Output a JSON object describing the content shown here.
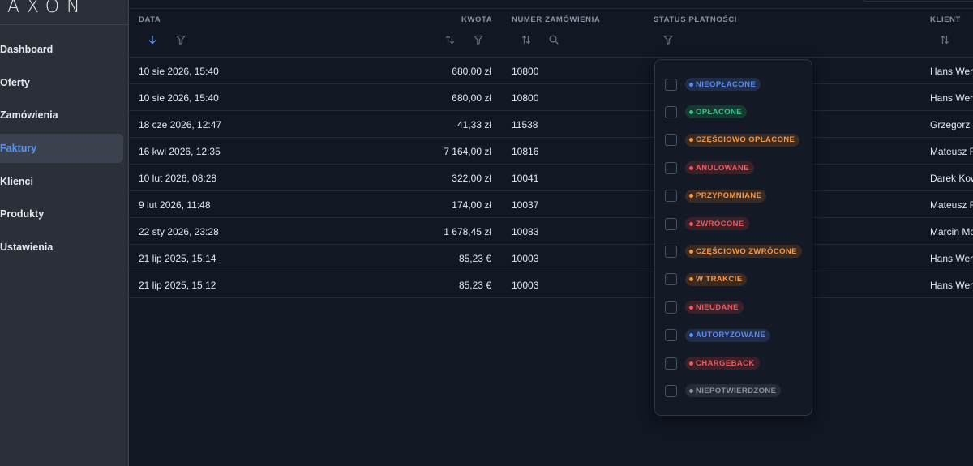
{
  "app": {
    "logo": "AXON"
  },
  "sidebar": {
    "items": [
      {
        "label": "Dashboard",
        "active": false
      },
      {
        "label": "Oferty",
        "active": false
      },
      {
        "label": "Zamówienia",
        "active": false
      },
      {
        "label": "Faktury",
        "active": true
      },
      {
        "label": "Klienci",
        "active": false
      },
      {
        "label": "Produkty",
        "active": false
      },
      {
        "label": "Ustawienia",
        "active": false
      }
    ]
  },
  "table": {
    "headers": {
      "date": "DATA",
      "amount": "KWOTA",
      "order_number": "NUMER ZAMÓWIENIA",
      "payment_status": "STATUS PŁATNOŚCI",
      "client": "KLIENT"
    },
    "rows": [
      {
        "date": "10 sie 2026, 15:40",
        "amount": "680,00 zł",
        "order": "10800",
        "client": "Hans Werr"
      },
      {
        "date": "10 sie 2026, 15:40",
        "amount": "680,00 zł",
        "order": "10800",
        "client": "Hans Werr"
      },
      {
        "date": "18 cze 2026, 12:47",
        "amount": "41,33 zł",
        "order": "11538",
        "client": "Grzegorz"
      },
      {
        "date": "16 kwi 2026, 12:35",
        "amount": "7 164,00 zł",
        "order": "10816",
        "client": "Mateusz F"
      },
      {
        "date": "10 lut 2026, 08:28",
        "amount": "322,00 zł",
        "order": "10041",
        "client": "Darek Kow"
      },
      {
        "date": "9 lut 2026, 11:48",
        "amount": "174,00 zł",
        "order": "10037",
        "client": "Mateusz F"
      },
      {
        "date": "22 sty 2026, 23:28",
        "amount": "1 678,45 zł",
        "order": "10083",
        "client": "Marcin Mc"
      },
      {
        "date": "21 lip 2025, 15:14",
        "amount": "85,23 €",
        "order": "10003",
        "client": "Hans Werr"
      },
      {
        "date": "21 lip 2025, 15:12",
        "amount": "85,23 €",
        "order": "10003",
        "client": "Hans Werr"
      }
    ]
  },
  "status_filter": {
    "options": [
      {
        "label": "NIEOPŁACONE",
        "color": "#5b8def",
        "bg": "#1f2d4a",
        "checked": false
      },
      {
        "label": "OPŁACONE",
        "color": "#34c38f",
        "bg": "#173a30",
        "checked": false
      },
      {
        "label": "CZĘŚCIOWO OPŁACONE",
        "color": "#f39a4a",
        "bg": "#3a2a22",
        "checked": false
      },
      {
        "label": "ANULOWANE",
        "color": "#ef5a62",
        "bg": "#3a2129",
        "checked": false
      },
      {
        "label": "PRZYPOMNIANE",
        "color": "#f39a4a",
        "bg": "#3a2a22",
        "checked": false
      },
      {
        "label": "ZWRÓCONE",
        "color": "#ef5a62",
        "bg": "#3a2129",
        "checked": false
      },
      {
        "label": "CZĘŚCIOWO ZWRÓCONE",
        "color": "#f39a4a",
        "bg": "#3a2a22",
        "checked": false
      },
      {
        "label": "W TRAKCIE",
        "color": "#f39a4a",
        "bg": "#3a2a22",
        "checked": false
      },
      {
        "label": "NIEUDANE",
        "color": "#ef5a62",
        "bg": "#3a2129",
        "checked": false
      },
      {
        "label": "AUTORYZOWANE",
        "color": "#5b8def",
        "bg": "#1f2d4a",
        "checked": false
      },
      {
        "label": "CHARGEBACK",
        "color": "#ef5a62",
        "bg": "#3a2129",
        "checked": false
      },
      {
        "label": "NIEPOTWIERDZONE",
        "color": "#8a93a3",
        "bg": "#262c36",
        "checked": false
      }
    ]
  },
  "colors": {
    "accent": "#5a94f0",
    "background": "#111723",
    "sidebar": "#2b2f38"
  }
}
